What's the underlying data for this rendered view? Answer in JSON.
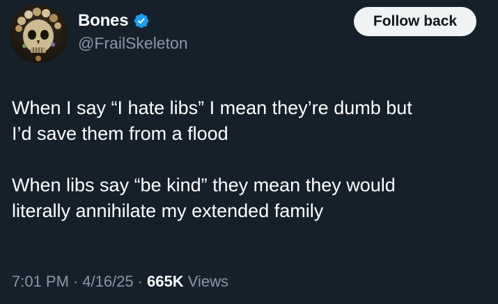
{
  "tweet": {
    "author": {
      "display_name": "Bones",
      "handle": "@FrailSkeleton",
      "verified": true,
      "avatar_icon": "skeleton-avatar"
    },
    "follow_button_label": "Follow back",
    "body": {
      "line1": "When I say “I hate libs” I mean they’re dumb but",
      "line2": "I’d save them from a flood",
      "line3": "When libs say “be kind” they mean they would",
      "line4": "literally annihilate my extended family"
    },
    "meta": {
      "time": "7:01 PM",
      "separator": "·",
      "date": "4/16/25",
      "views_count": "665K",
      "views_label": "Views"
    }
  },
  "colors": {
    "background": "#15202b",
    "text_primary": "#ffffff",
    "text_secondary": "#8b98a5",
    "verified_badge": "#1d9bf0",
    "button_bg": "#eff3f4",
    "button_text": "#0f1419"
  }
}
